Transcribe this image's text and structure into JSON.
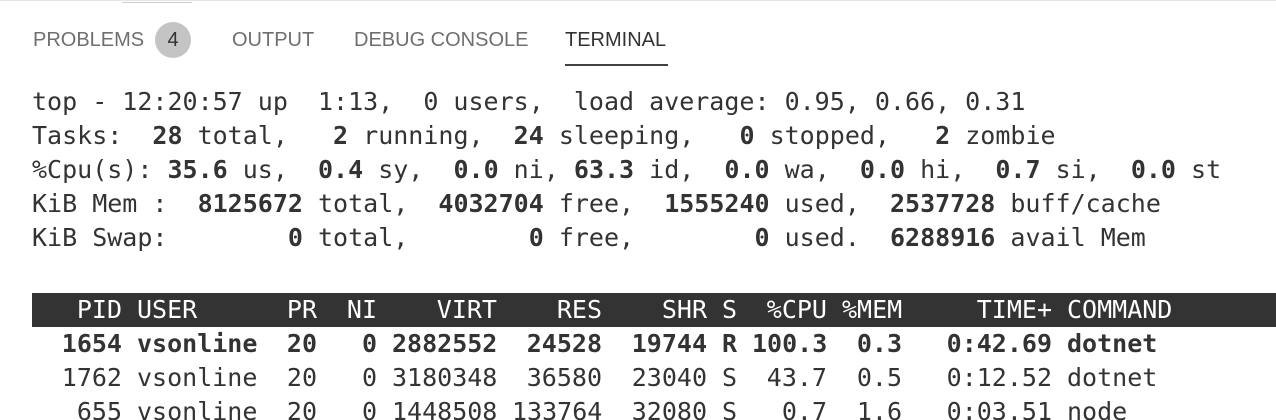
{
  "panel": {
    "tabs": [
      {
        "label": "PROBLEMS",
        "badge": "4"
      },
      {
        "label": "OUTPUT"
      },
      {
        "label": "DEBUG CONSOLE"
      },
      {
        "label": "TERMINAL",
        "active": true
      }
    ]
  },
  "top": {
    "uptime_line": {
      "prefix": "top - 12:20:57 up  1:13,  0 users,  load average: 0.95, 0.66, 0.31"
    },
    "tasks": {
      "label": "Tasks: ",
      "total": " 28",
      "total_label": " total,   ",
      "running": "2",
      "running_label": " running,  ",
      "sleeping": "24",
      "sleeping_label": " sleeping,   ",
      "stopped": "0",
      "stopped_label": " stopped,   ",
      "zombie": "2",
      "zombie_label": " zombie"
    },
    "cpu": {
      "label": "%Cpu(s): ",
      "us": "35.6",
      "us_label": " us,  ",
      "sy": "0.4",
      "sy_label": " sy,  ",
      "ni": "0.0",
      "ni_label": " ni, ",
      "id": "63.3",
      "id_label": " id,  ",
      "wa": "0.0",
      "wa_label": " wa,  ",
      "hi": "0.0",
      "hi_label": " hi,  ",
      "si": "0.7",
      "si_label": " si,  ",
      "st": "0.0",
      "st_label": " st"
    },
    "mem": {
      "label": "KiB Mem :  ",
      "total": "8125672",
      "total_label": " total,  ",
      "free": "4032704",
      "free_label": " free,  ",
      "used": "1555240",
      "used_label": " used,  ",
      "buff": "2537728",
      "buff_label": " buff/cache"
    },
    "swap": {
      "label": "KiB Swap:        ",
      "total": "0",
      "total_label": " total,        ",
      "free": "0",
      "free_label": " free,        ",
      "used": "0",
      "used_label": " used.  ",
      "avail": "6288916",
      "avail_label": " avail Mem"
    },
    "columns": [
      "PID",
      "USER",
      "PR",
      "NI",
      "VIRT",
      "RES",
      "SHR",
      "S",
      "%CPU",
      "%MEM",
      "TIME+",
      "COMMAND"
    ],
    "processes": [
      {
        "pid": "1654",
        "user": "vsonline",
        "pr": "20",
        "ni": "0",
        "virt": "2882552",
        "res": "24528",
        "shr": "19744",
        "s": "R",
        "cpu": "100.3",
        "mem": "0.3",
        "time": "0:42.69",
        "command": "dotnet"
      },
      {
        "pid": "1762",
        "user": "vsonline",
        "pr": "20",
        "ni": "0",
        "virt": "3180348",
        "res": "36580",
        "shr": "23040",
        "s": "S",
        "cpu": "43.7",
        "mem": "0.5",
        "time": "0:12.52",
        "command": "dotnet"
      },
      {
        "pid": "655",
        "user": "vsonline",
        "pr": "20",
        "ni": "0",
        "virt": "1448508",
        "res": "133764",
        "shr": "32080",
        "s": "S",
        "cpu": "0.7",
        "mem": "1.6",
        "time": "0:03.51",
        "command": "node"
      }
    ]
  }
}
